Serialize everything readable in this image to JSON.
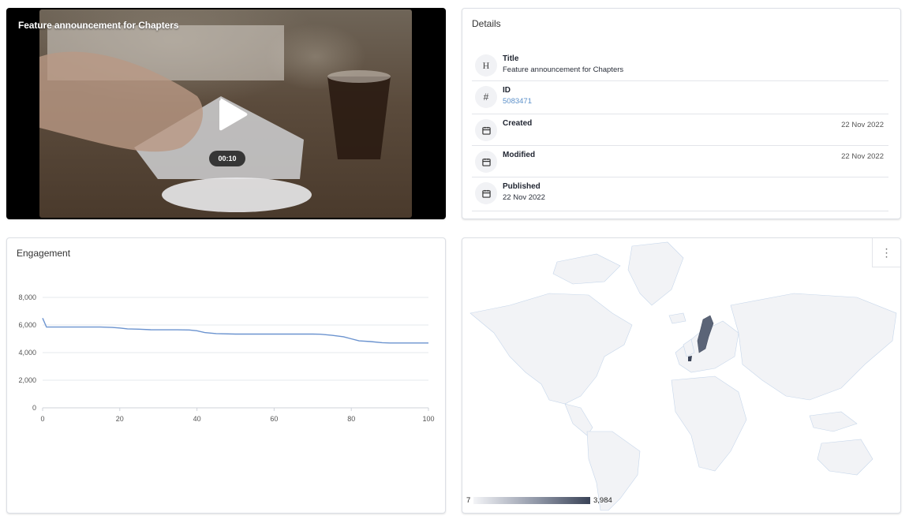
{
  "video": {
    "title": "Feature announcement for Chapters",
    "duration": "00:10"
  },
  "details": {
    "heading": "Details",
    "rows": [
      {
        "icon": "H",
        "label": "Title",
        "value": "Feature announcement for Chapters",
        "date": ""
      },
      {
        "icon": "#",
        "label": "ID",
        "value": "5083471",
        "date": ""
      },
      {
        "icon": "calendar-icon",
        "label": "Created",
        "value": "",
        "date": "22 Nov 2022"
      },
      {
        "icon": "calendar-icon",
        "label": "Modified",
        "value": "",
        "date": "22 Nov 2022"
      },
      {
        "icon": "calendar-icon",
        "label": "Published",
        "value": "22 Nov 2022",
        "date": ""
      }
    ]
  },
  "engagement": {
    "heading": "Engagement"
  },
  "map": {
    "legend_min": "7",
    "legend_max": "3,984",
    "colors": {
      "low": "#f3f4f7",
      "high": "#3a4357"
    }
  },
  "chart_data": {
    "type": "line",
    "xlabel": "",
    "ylabel": "",
    "xlim": [
      0,
      100
    ],
    "ylim": [
      0,
      8000
    ],
    "x_ticks": [
      0,
      20,
      40,
      60,
      80,
      100
    ],
    "y_ticks": [
      0,
      2000,
      4000,
      6000,
      8000
    ],
    "x_tick_labels": [
      "0",
      "20",
      "40",
      "60",
      "80",
      "100"
    ],
    "y_tick_labels": [
      "0",
      "2,000",
      "4,000",
      "6,000",
      "8,000"
    ],
    "grid": true,
    "series": [
      {
        "color": "#6b93cf",
        "x": [
          0,
          1,
          5,
          10,
          15,
          18,
          20,
          22,
          25,
          28,
          30,
          35,
          38,
          40,
          42,
          45,
          50,
          55,
          60,
          65,
          70,
          72,
          75,
          78,
          80,
          82,
          85,
          88,
          90,
          95,
          100
        ],
        "y": [
          6500,
          5850,
          5850,
          5850,
          5850,
          5820,
          5780,
          5720,
          5700,
          5660,
          5650,
          5650,
          5640,
          5580,
          5450,
          5380,
          5340,
          5340,
          5340,
          5340,
          5340,
          5330,
          5250,
          5150,
          5000,
          4850,
          4800,
          4720,
          4700,
          4700,
          4700
        ]
      }
    ]
  }
}
